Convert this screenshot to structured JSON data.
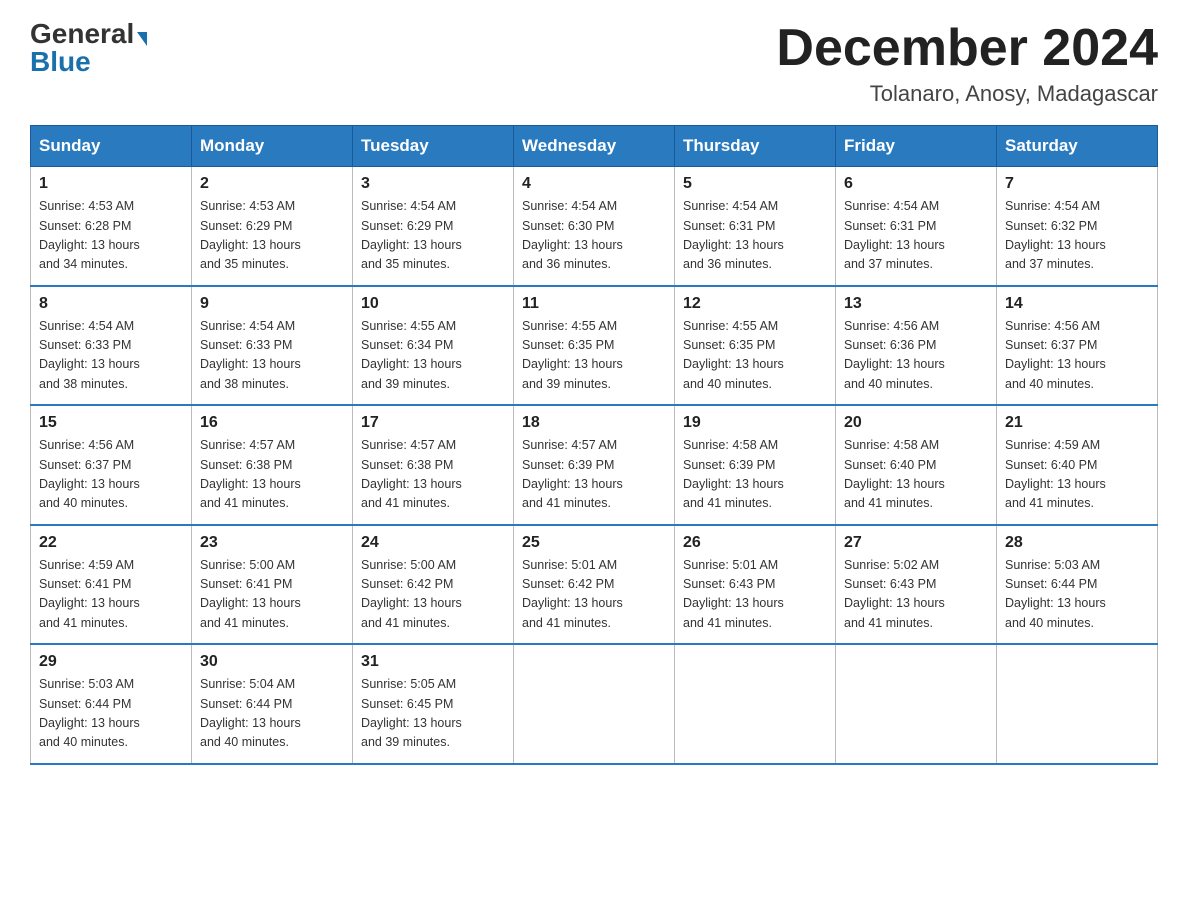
{
  "header": {
    "logo_general": "General",
    "logo_blue": "Blue",
    "month_title": "December 2024",
    "location": "Tolanaro, Anosy, Madagascar"
  },
  "days_of_week": [
    "Sunday",
    "Monday",
    "Tuesday",
    "Wednesday",
    "Thursday",
    "Friday",
    "Saturday"
  ],
  "weeks": [
    [
      {
        "day": "1",
        "sunrise": "4:53 AM",
        "sunset": "6:28 PM",
        "daylight": "13 hours and 34 minutes."
      },
      {
        "day": "2",
        "sunrise": "4:53 AM",
        "sunset": "6:29 PM",
        "daylight": "13 hours and 35 minutes."
      },
      {
        "day": "3",
        "sunrise": "4:54 AM",
        "sunset": "6:29 PM",
        "daylight": "13 hours and 35 minutes."
      },
      {
        "day": "4",
        "sunrise": "4:54 AM",
        "sunset": "6:30 PM",
        "daylight": "13 hours and 36 minutes."
      },
      {
        "day": "5",
        "sunrise": "4:54 AM",
        "sunset": "6:31 PM",
        "daylight": "13 hours and 36 minutes."
      },
      {
        "day": "6",
        "sunrise": "4:54 AM",
        "sunset": "6:31 PM",
        "daylight": "13 hours and 37 minutes."
      },
      {
        "day": "7",
        "sunrise": "4:54 AM",
        "sunset": "6:32 PM",
        "daylight": "13 hours and 37 minutes."
      }
    ],
    [
      {
        "day": "8",
        "sunrise": "4:54 AM",
        "sunset": "6:33 PM",
        "daylight": "13 hours and 38 minutes."
      },
      {
        "day": "9",
        "sunrise": "4:54 AM",
        "sunset": "6:33 PM",
        "daylight": "13 hours and 38 minutes."
      },
      {
        "day": "10",
        "sunrise": "4:55 AM",
        "sunset": "6:34 PM",
        "daylight": "13 hours and 39 minutes."
      },
      {
        "day": "11",
        "sunrise": "4:55 AM",
        "sunset": "6:35 PM",
        "daylight": "13 hours and 39 minutes."
      },
      {
        "day": "12",
        "sunrise": "4:55 AM",
        "sunset": "6:35 PM",
        "daylight": "13 hours and 40 minutes."
      },
      {
        "day": "13",
        "sunrise": "4:56 AM",
        "sunset": "6:36 PM",
        "daylight": "13 hours and 40 minutes."
      },
      {
        "day": "14",
        "sunrise": "4:56 AM",
        "sunset": "6:37 PM",
        "daylight": "13 hours and 40 minutes."
      }
    ],
    [
      {
        "day": "15",
        "sunrise": "4:56 AM",
        "sunset": "6:37 PM",
        "daylight": "13 hours and 40 minutes."
      },
      {
        "day": "16",
        "sunrise": "4:57 AM",
        "sunset": "6:38 PM",
        "daylight": "13 hours and 41 minutes."
      },
      {
        "day": "17",
        "sunrise": "4:57 AM",
        "sunset": "6:38 PM",
        "daylight": "13 hours and 41 minutes."
      },
      {
        "day": "18",
        "sunrise": "4:57 AM",
        "sunset": "6:39 PM",
        "daylight": "13 hours and 41 minutes."
      },
      {
        "day": "19",
        "sunrise": "4:58 AM",
        "sunset": "6:39 PM",
        "daylight": "13 hours and 41 minutes."
      },
      {
        "day": "20",
        "sunrise": "4:58 AM",
        "sunset": "6:40 PM",
        "daylight": "13 hours and 41 minutes."
      },
      {
        "day": "21",
        "sunrise": "4:59 AM",
        "sunset": "6:40 PM",
        "daylight": "13 hours and 41 minutes."
      }
    ],
    [
      {
        "day": "22",
        "sunrise": "4:59 AM",
        "sunset": "6:41 PM",
        "daylight": "13 hours and 41 minutes."
      },
      {
        "day": "23",
        "sunrise": "5:00 AM",
        "sunset": "6:41 PM",
        "daylight": "13 hours and 41 minutes."
      },
      {
        "day": "24",
        "sunrise": "5:00 AM",
        "sunset": "6:42 PM",
        "daylight": "13 hours and 41 minutes."
      },
      {
        "day": "25",
        "sunrise": "5:01 AM",
        "sunset": "6:42 PM",
        "daylight": "13 hours and 41 minutes."
      },
      {
        "day": "26",
        "sunrise": "5:01 AM",
        "sunset": "6:43 PM",
        "daylight": "13 hours and 41 minutes."
      },
      {
        "day": "27",
        "sunrise": "5:02 AM",
        "sunset": "6:43 PM",
        "daylight": "13 hours and 41 minutes."
      },
      {
        "day": "28",
        "sunrise": "5:03 AM",
        "sunset": "6:44 PM",
        "daylight": "13 hours and 40 minutes."
      }
    ],
    [
      {
        "day": "29",
        "sunrise": "5:03 AM",
        "sunset": "6:44 PM",
        "daylight": "13 hours and 40 minutes."
      },
      {
        "day": "30",
        "sunrise": "5:04 AM",
        "sunset": "6:44 PM",
        "daylight": "13 hours and 40 minutes."
      },
      {
        "day": "31",
        "sunrise": "5:05 AM",
        "sunset": "6:45 PM",
        "daylight": "13 hours and 39 minutes."
      },
      null,
      null,
      null,
      null
    ]
  ],
  "labels": {
    "sunrise": "Sunrise:",
    "sunset": "Sunset:",
    "daylight": "Daylight:"
  }
}
